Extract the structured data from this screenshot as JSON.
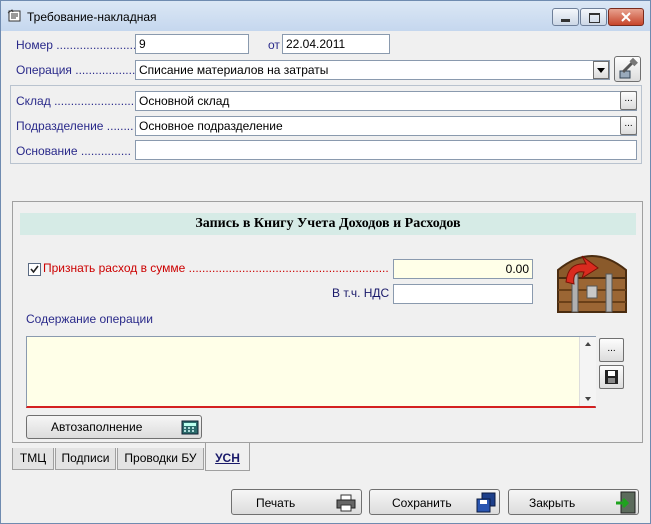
{
  "window": {
    "title": "Требование-накладная"
  },
  "form": {
    "number_label": "Номер ........................",
    "number_value": "9",
    "date_label": "от",
    "date_value": "22.04.2011",
    "operation_label": "Операция ...................",
    "operation_value": "Списание материалов на затраты",
    "warehouse_label": "Склад .........................",
    "warehouse_value": "Основной склад",
    "department_label": "Подразделение ........",
    "department_value": "Основное подразделение",
    "basis_label": "Основание ...............",
    "basis_value": ""
  },
  "usn_panel": {
    "header": "Запись в Книгу Учета Доходов и Расходов",
    "recognize_label": "Признать расход в сумме ..............................................................",
    "recognize_checked": true,
    "amount_value": "0.00",
    "vat_label": "В т.ч. НДС",
    "vat_value": "",
    "content_label": "Содержание операции",
    "content_value": "",
    "autofill_label": "Автозаполнение"
  },
  "tabs": [
    {
      "label": "ТМЦ"
    },
    {
      "label": "Подписи"
    },
    {
      "label": "Проводки БУ"
    },
    {
      "label": "УСН"
    }
  ],
  "buttons": {
    "print_label": "Печать",
    "save_label": "Сохранить",
    "close_label": "Закрыть",
    "ellipsis": "..."
  },
  "colors": {
    "header_bg": "#d6ebe6",
    "required_label": "#cc0000",
    "label": "#2a2a8a",
    "memo_bg": "#ffffe8"
  }
}
